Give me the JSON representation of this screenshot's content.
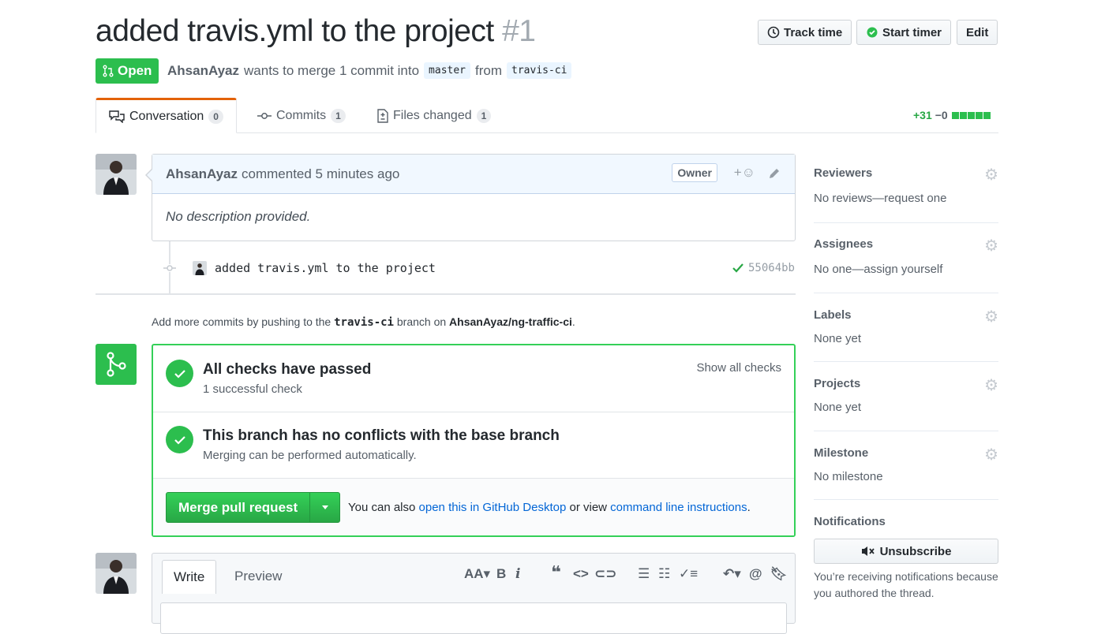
{
  "header": {
    "title": "added travis.yml to the project",
    "number": "#1",
    "buttons": {
      "track_time": "Track time",
      "start_timer": "Start timer",
      "edit": "Edit"
    }
  },
  "pr_meta": {
    "state": "Open",
    "author": "AhsanAyaz",
    "text_merge": "wants to merge 1 commit into",
    "base": "master",
    "text_from": "from",
    "head": "travis-ci"
  },
  "tabs": [
    {
      "label": "Conversation",
      "count": "0",
      "icon": "comment-discussion-icon"
    },
    {
      "label": "Commits",
      "count": "1",
      "icon": "git-commit-icon"
    },
    {
      "label": "Files changed",
      "count": "1",
      "icon": "file-diff-icon"
    }
  ],
  "diffstat": {
    "additions": "+31",
    "deletions": "−0"
  },
  "comment": {
    "author": "AhsanAyaz",
    "time_text": "commented 5 minutes ago",
    "badge": "Owner",
    "body": "No description provided."
  },
  "commit": {
    "message": "added travis.yml to the project",
    "sha": "55064bb"
  },
  "add_more": {
    "prefix": "Add more commits by pushing to the",
    "branch": "travis-ci",
    "middle": "branch on",
    "repo": "AhsanAyaz/ng-traffic-ci",
    "suffix": "."
  },
  "merge": {
    "checks_title": "All checks have passed",
    "checks_sub": "1 successful check",
    "show_all": "Show all checks",
    "conflict_title": "This branch has no conflicts with the base branch",
    "conflict_sub": "Merging can be performed automatically.",
    "button": "Merge pull request",
    "hint_prefix": "You can also",
    "hint_link1": "open this in GitHub Desktop",
    "hint_or": "or view",
    "hint_link2": "command line instructions",
    "hint_end": "."
  },
  "editor": {
    "write_tab": "Write",
    "preview_tab": "Preview"
  },
  "sidebar": {
    "reviewers": {
      "heading": "Reviewers",
      "value": "No reviews—request one"
    },
    "assignees": {
      "heading": "Assignees",
      "value": "No one—assign yourself"
    },
    "labels": {
      "heading": "Labels",
      "value": "None yet"
    },
    "projects": {
      "heading": "Projects",
      "value": "None yet"
    },
    "milestone": {
      "heading": "Milestone",
      "value": "No milestone"
    },
    "notifications": {
      "heading": "Notifications",
      "button": "Unsubscribe",
      "note": "You’re receiving notifications because you authored the thread."
    }
  },
  "colors": {
    "green": "#2cbe4e",
    "link": "#0366d6",
    "tab_accent": "#e36209"
  }
}
